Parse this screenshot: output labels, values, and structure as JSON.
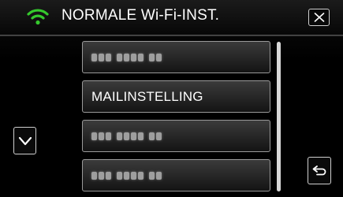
{
  "header": {
    "title": "NORMALE Wi-Fi-INST.",
    "wifi_icon": "wifi-icon",
    "wifi_color": "#35c92d",
    "close_icon": "close-icon"
  },
  "list": {
    "items": [
      {
        "label": "",
        "masked": true
      },
      {
        "label": "MAILINSTELLING",
        "masked": false
      },
      {
        "label": "",
        "masked": true
      },
      {
        "label": "",
        "masked": true
      }
    ]
  },
  "nav": {
    "down_icon": "chevron-down-icon",
    "back_icon": "return-icon"
  }
}
